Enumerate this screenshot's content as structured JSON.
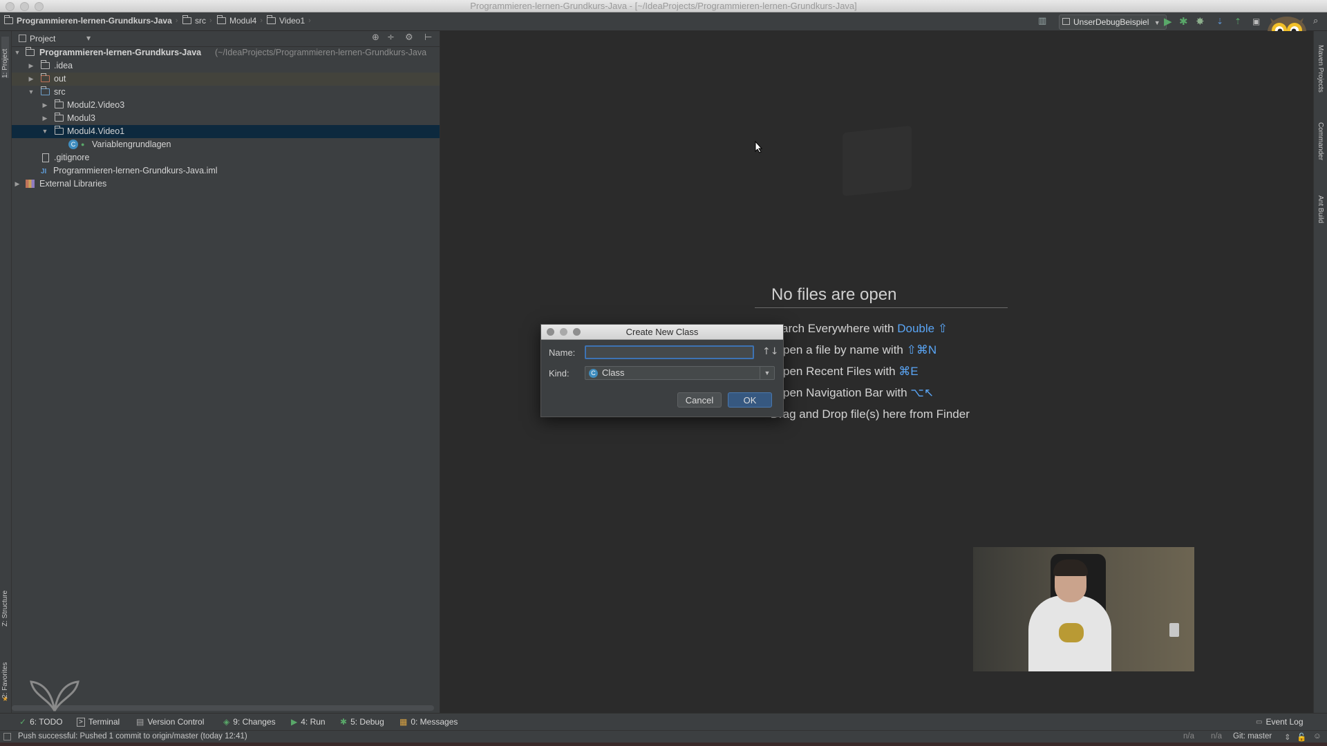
{
  "window": {
    "title": "Programmieren-lernen-Grundkurs-Java - [~/IdeaProjects/Programmieren-lernen-Grundkurs-Java]"
  },
  "navbar": {
    "breadcrumbs": [
      {
        "label": "Programmieren-lernen-Grundkurs-Java"
      },
      {
        "label": "src"
      },
      {
        "label": "Modul4"
      },
      {
        "label": "Video1"
      }
    ],
    "run_config": "UnserDebugBeispiel"
  },
  "left_strip": {
    "project": "1: Project",
    "structure": "Z: Structure",
    "favorites": "2: Favorites"
  },
  "right_strip": {
    "maven": "Maven Projects",
    "commander": "Commander",
    "ant": "Ant Build"
  },
  "project_panel": {
    "header": "Project",
    "tree": [
      {
        "label": "Programmieren-lernen-Grundkurs-Java",
        "suffix": "(~/IdeaProjects/Programmieren-lernen-Grundkurs-Java"
      },
      {
        "label": ".idea"
      },
      {
        "label": "out"
      },
      {
        "label": "src"
      },
      {
        "label": "Modul2.Video3"
      },
      {
        "label": "Modul3"
      },
      {
        "label": "Modul4.Video1"
      },
      {
        "label": "Variablengrundlagen"
      },
      {
        "label": ".gitignore"
      },
      {
        "label": "Programmieren-lernen-Grundkurs-Java.iml"
      },
      {
        "label": "External Libraries"
      }
    ]
  },
  "editor": {
    "empty_title": "No files are open",
    "hints": [
      {
        "text": "arch Everywhere with ",
        "key": "Double ⇧"
      },
      {
        "text": "pen a file by name with ",
        "key": "⇧⌘N"
      },
      {
        "text": "pen Recent Files with ",
        "key": "⌘E"
      },
      {
        "text": "pen Navigation Bar with ",
        "key": "⌥↖"
      },
      {
        "text": "Drag and Drop file(s) here from Finder",
        "key": ""
      }
    ]
  },
  "dialog": {
    "title": "Create New Class",
    "name_label": "Name:",
    "name_value": "",
    "kind_label": "Kind:",
    "kind_value": "Class",
    "cancel": "Cancel",
    "ok": "OK"
  },
  "tool_windows": [
    {
      "label": "6: TODO"
    },
    {
      "label": "Terminal"
    },
    {
      "label": "Version Control"
    },
    {
      "label": "9: Changes"
    },
    {
      "label": "4: Run"
    },
    {
      "label": "5: Debug"
    },
    {
      "label": "0: Messages"
    }
  ],
  "event_log": "Event Log",
  "status": {
    "message": "Push successful: Pushed 1 commit to origin/master (today 12:41)",
    "pos1": "n/a",
    "pos2": "n/a",
    "git": "Git: master"
  },
  "colors": {
    "accent": "#5aa5f5",
    "selection": "#0d293e",
    "background": "#2b2b2b",
    "panel": "#3c3f41"
  }
}
